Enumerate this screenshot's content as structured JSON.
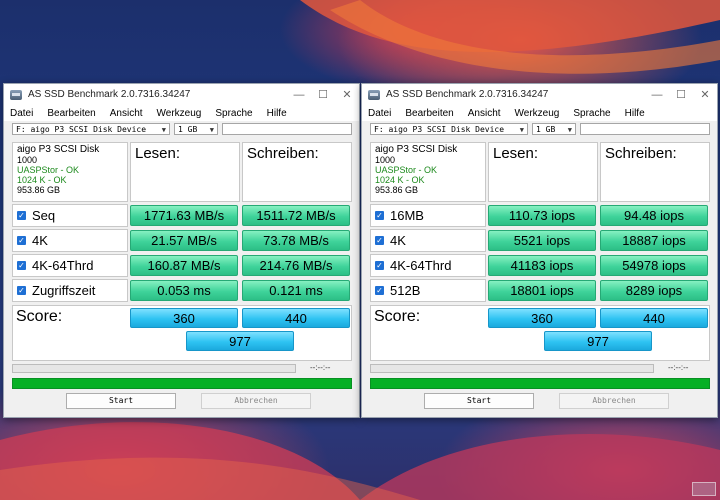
{
  "colors": {
    "result_green": "#3fd39a",
    "score_blue": "#2ec3f2",
    "progress_green": "#06b025",
    "ok_text": "#1d8a1d"
  },
  "windows": [
    {
      "title": "AS SSD Benchmark 2.0.7316.34247",
      "menu": [
        "Datei",
        "Bearbeiten",
        "Ansicht",
        "Werkzeug",
        "Sprache",
        "Hilfe"
      ],
      "device_select": "F: aigo P3 SCSI Disk Device",
      "size_select": "1 GB",
      "info": {
        "name": "aigo P3 SCSI Disk",
        "firmware": "1000",
        "driver_status": "UASPStor - OK",
        "align_status": "1024 K - OK",
        "capacity": "953.86 GB"
      },
      "headers": {
        "read": "Lesen:",
        "write": "Schreiben:"
      },
      "rows": [
        {
          "label": "Seq",
          "read": "1771.63 MB/s",
          "write": "1511.72 MB/s"
        },
        {
          "label": "4K",
          "read": "21.57 MB/s",
          "write": "73.78 MB/s"
        },
        {
          "label": "4K-64Thrd",
          "read": "160.87 MB/s",
          "write": "214.76 MB/s"
        },
        {
          "label": "Zugriffszeit",
          "read": "0.053 ms",
          "write": "0.121 ms"
        }
      ],
      "score": {
        "label": "Score:",
        "read": "360",
        "write": "440",
        "total": "977"
      },
      "timer": "--:--:--",
      "buttons": {
        "start": "Start",
        "abort": "Abbrechen"
      }
    },
    {
      "title": "AS SSD Benchmark 2.0.7316.34247",
      "menu": [
        "Datei",
        "Bearbeiten",
        "Ansicht",
        "Werkzeug",
        "Sprache",
        "Hilfe"
      ],
      "device_select": "F: aigo P3 SCSI Disk Device",
      "size_select": "1 GB",
      "info": {
        "name": "aigo P3 SCSI Disk",
        "firmware": "1000",
        "driver_status": "UASPStor - OK",
        "align_status": "1024 K - OK",
        "capacity": "953.86 GB"
      },
      "headers": {
        "read": "Lesen:",
        "write": "Schreiben:"
      },
      "rows": [
        {
          "label": "16MB",
          "read": "110.73 iops",
          "write": "94.48 iops"
        },
        {
          "label": "4K",
          "read": "5521 iops",
          "write": "18887 iops"
        },
        {
          "label": "4K-64Thrd",
          "read": "41183 iops",
          "write": "54978 iops"
        },
        {
          "label": "512B",
          "read": "18801 iops",
          "write": "8289 iops"
        }
      ],
      "score": {
        "label": "Score:",
        "read": "360",
        "write": "440",
        "total": "977"
      },
      "timer": "--:--:--",
      "buttons": {
        "start": "Start",
        "abort": "Abbrechen"
      }
    }
  ]
}
